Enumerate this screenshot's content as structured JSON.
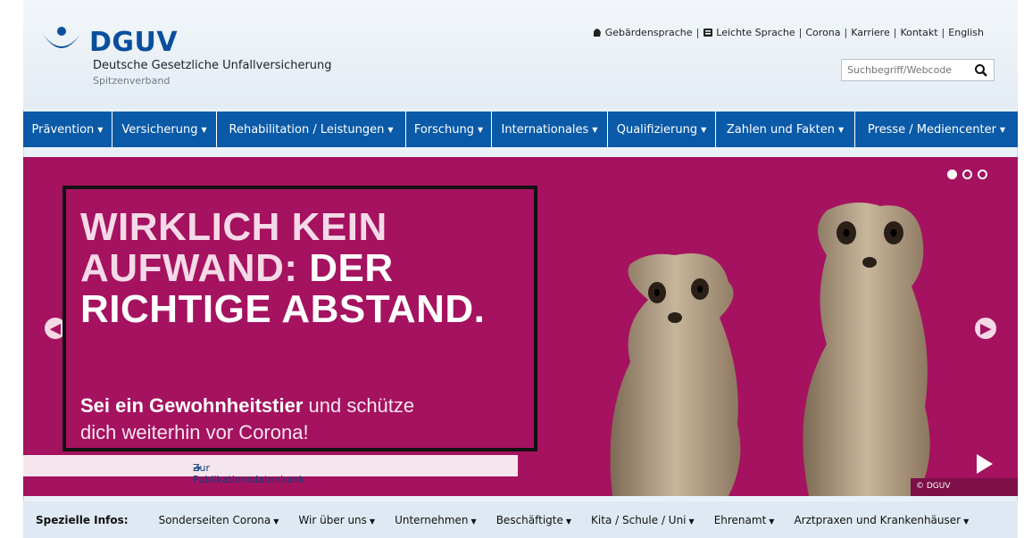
{
  "brand": {
    "logo_text": "DGUV",
    "name": "Deutsche Gesetzliche Unfallversicherung",
    "subtitle": "Spitzenverband",
    "color": "#0a4f9e"
  },
  "toplinks": [
    {
      "label": "Gebärdensprache",
      "icon": "sign-language-icon"
    },
    {
      "label": "Leichte Sprache",
      "icon": "easy-language-icon"
    },
    {
      "label": "Corona"
    },
    {
      "label": "Karriere"
    },
    {
      "label": "Kontakt"
    },
    {
      "label": "English"
    }
  ],
  "search": {
    "placeholder": "Suchbegriff/Webcode",
    "icon": "search-icon"
  },
  "nav": {
    "color": "#0a5aa8",
    "items": [
      {
        "label": "Prävention"
      },
      {
        "label": "Versicherung"
      },
      {
        "label": "Rehabilitation / Leistungen"
      },
      {
        "label": "Forschung"
      },
      {
        "label": "Internationales"
      },
      {
        "label": "Qualifizierung"
      },
      {
        "label": "Zahlen und Fakten"
      },
      {
        "label": "Presse / Mediencenter"
      }
    ]
  },
  "hero": {
    "background": "#a5125f",
    "headline_line1": "WIRKLICH KEIN",
    "headline_line2a": "AUFWAND: ",
    "headline_line2b": "DER",
    "headline_line3": "RICHTIGE ABSTAND.",
    "sub_bold": "Sei ein Gewohnheitstier",
    "sub_rest1": " und schütze",
    "sub_line2": "dich weiterhin vor Corona!",
    "pub_link": "Zur Publikationsdatenbank",
    "copyright": "© DGUV",
    "slides_total": 3,
    "slide_active": 1
  },
  "specials": {
    "label": "Spezielle Infos:",
    "items": [
      {
        "label": "Sonderseiten Corona"
      },
      {
        "label": "Wir über uns"
      },
      {
        "label": "Unternehmen"
      },
      {
        "label": "Beschäftigte"
      },
      {
        "label": "Kita / Schule / Uni"
      },
      {
        "label": "Ehrenamt"
      },
      {
        "label": "Arztpraxen und Krankenhäuser"
      }
    ]
  }
}
